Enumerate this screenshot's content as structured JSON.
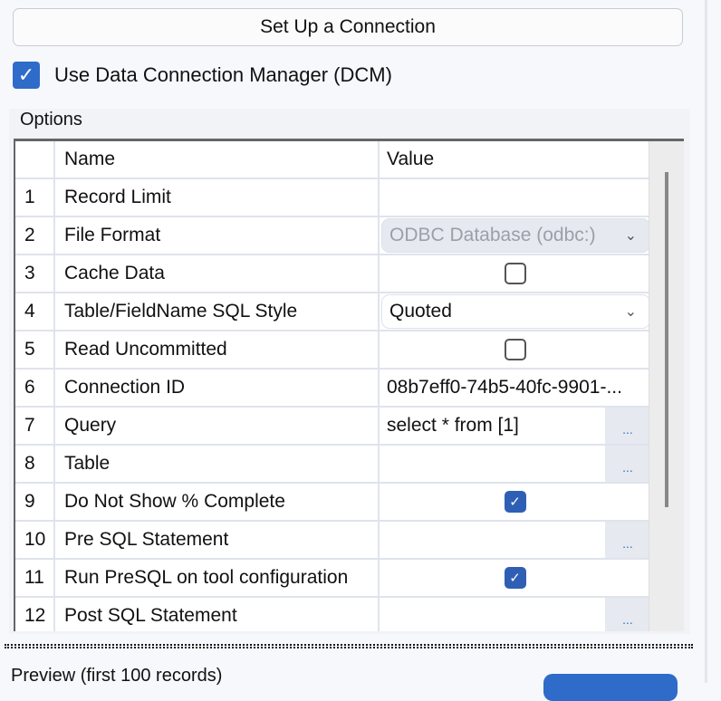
{
  "setup_button": "Set Up a Connection",
  "dcm": {
    "label": "Use Data Connection Manager (DCM)",
    "checked": true
  },
  "options": {
    "title": "Options",
    "headers": {
      "num": "",
      "name": "Name",
      "value": "Value"
    },
    "rows": [
      {
        "n": "1",
        "name": "Record Limit",
        "value": ""
      },
      {
        "n": "2",
        "name": "File Format",
        "value": "ODBC Database (odbc:)"
      },
      {
        "n": "3",
        "name": "Cache Data",
        "value": ""
      },
      {
        "n": "4",
        "name": "Table/FieldName SQL Style",
        "value": "Quoted"
      },
      {
        "n": "5",
        "name": "Read Uncommitted",
        "value": ""
      },
      {
        "n": "6",
        "name": "Connection ID",
        "value": "08b7eff0-74b5-40fc-9901-..."
      },
      {
        "n": "7",
        "name": "Query",
        "value": "select * from [1]"
      },
      {
        "n": "8",
        "name": "Table",
        "value": ""
      },
      {
        "n": "9",
        "name": "Do Not Show % Complete",
        "value": ""
      },
      {
        "n": "10",
        "name": "Pre SQL Statement",
        "value": ""
      },
      {
        "n": "11",
        "name": "Run PreSQL on tool configuration",
        "value": ""
      },
      {
        "n": "12",
        "name": "Post SQL Statement",
        "value": ""
      }
    ],
    "ellipsis": "...",
    "check": "✓",
    "chevron": "⌄"
  },
  "preview_label": "Preview (first 100 records)"
}
